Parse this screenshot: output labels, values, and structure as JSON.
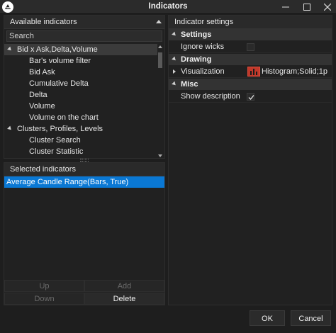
{
  "window": {
    "title": "Indicators",
    "logo": "atas-logo-icon"
  },
  "available_indicators": {
    "header": "Available indicators",
    "search_placeholder": "Search",
    "items": [
      {
        "label": "Bid x Ask,Delta,Volume",
        "type": "group",
        "expanded": true,
        "selected": true
      },
      {
        "label": "Bar's volume filter",
        "type": "child"
      },
      {
        "label": "Bid Ask",
        "type": "child"
      },
      {
        "label": "Cumulative Delta",
        "type": "child"
      },
      {
        "label": "Delta",
        "type": "child"
      },
      {
        "label": "Volume",
        "type": "child"
      },
      {
        "label": "Volume on the chart",
        "type": "child"
      },
      {
        "label": "Clusters, Profiles, Levels",
        "type": "group",
        "expanded": true
      },
      {
        "label": "Cluster Search",
        "type": "child"
      },
      {
        "label": "Cluster Statistic",
        "type": "child"
      }
    ]
  },
  "selected_indicators": {
    "header": "Selected indicators",
    "items": [
      "Average Candle Range(Bars, True)"
    ],
    "buttons": {
      "up": "Up",
      "add": "Add",
      "down": "Down",
      "delete": "Delete"
    }
  },
  "indicator_settings": {
    "header": "Indicator settings",
    "categories": {
      "settings": "Settings",
      "drawing": "Drawing",
      "misc": "Misc"
    },
    "properties": {
      "ignore_wicks": {
        "name": "Ignore wicks",
        "checked": false
      },
      "visualization": {
        "name": "Visualization",
        "value": "Histogram;Solid;1p"
      },
      "show_description": {
        "name": "Show description",
        "checked": true
      }
    },
    "accent_color": "#c0392b"
  },
  "footer": {
    "ok": "OK",
    "cancel": "Cancel"
  },
  "colors": {
    "background": "#1e1e1e",
    "selection": "#0a78d4"
  }
}
